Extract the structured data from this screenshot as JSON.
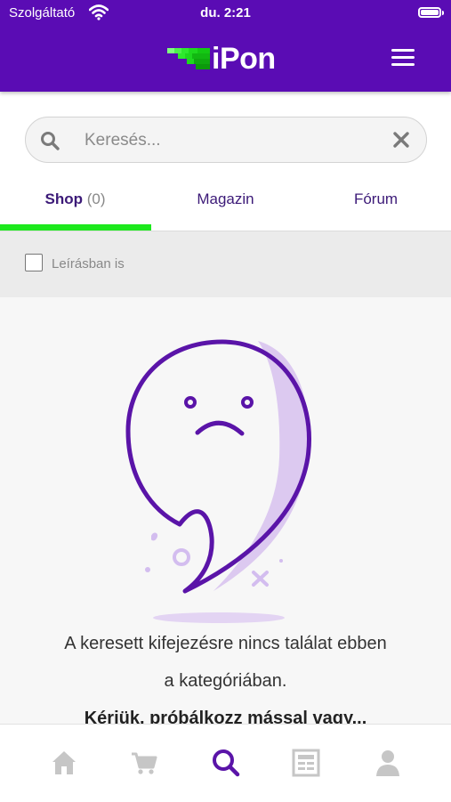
{
  "status": {
    "carrier": "Szolgáltató",
    "time": "du. 2:21"
  },
  "header": {
    "logo_text": "iPon",
    "brand_color": "#5a0cb4",
    "accent_color": "#1de91d"
  },
  "search": {
    "placeholder": "Keresés..."
  },
  "tabs": [
    {
      "label": "Shop",
      "count": "(0)",
      "active": true
    },
    {
      "label": "Magazin",
      "count": "",
      "active": false
    },
    {
      "label": "Fórum",
      "count": "",
      "active": false
    }
  ],
  "filter": {
    "label": "Leírásban is",
    "checked": false
  },
  "empty_state": {
    "line1": "A keresett kifejezésre nincs találat ebben",
    "line2": "a kategóriában.",
    "line3": "Kérjük, próbálkozz mással vagy..."
  },
  "bottom_nav": {
    "items": [
      {
        "icon": "home-icon",
        "active": false
      },
      {
        "icon": "cart-icon",
        "active": false
      },
      {
        "icon": "search-icon",
        "active": true
      },
      {
        "icon": "news-icon",
        "active": false
      },
      {
        "icon": "profile-icon",
        "active": false
      }
    ]
  }
}
